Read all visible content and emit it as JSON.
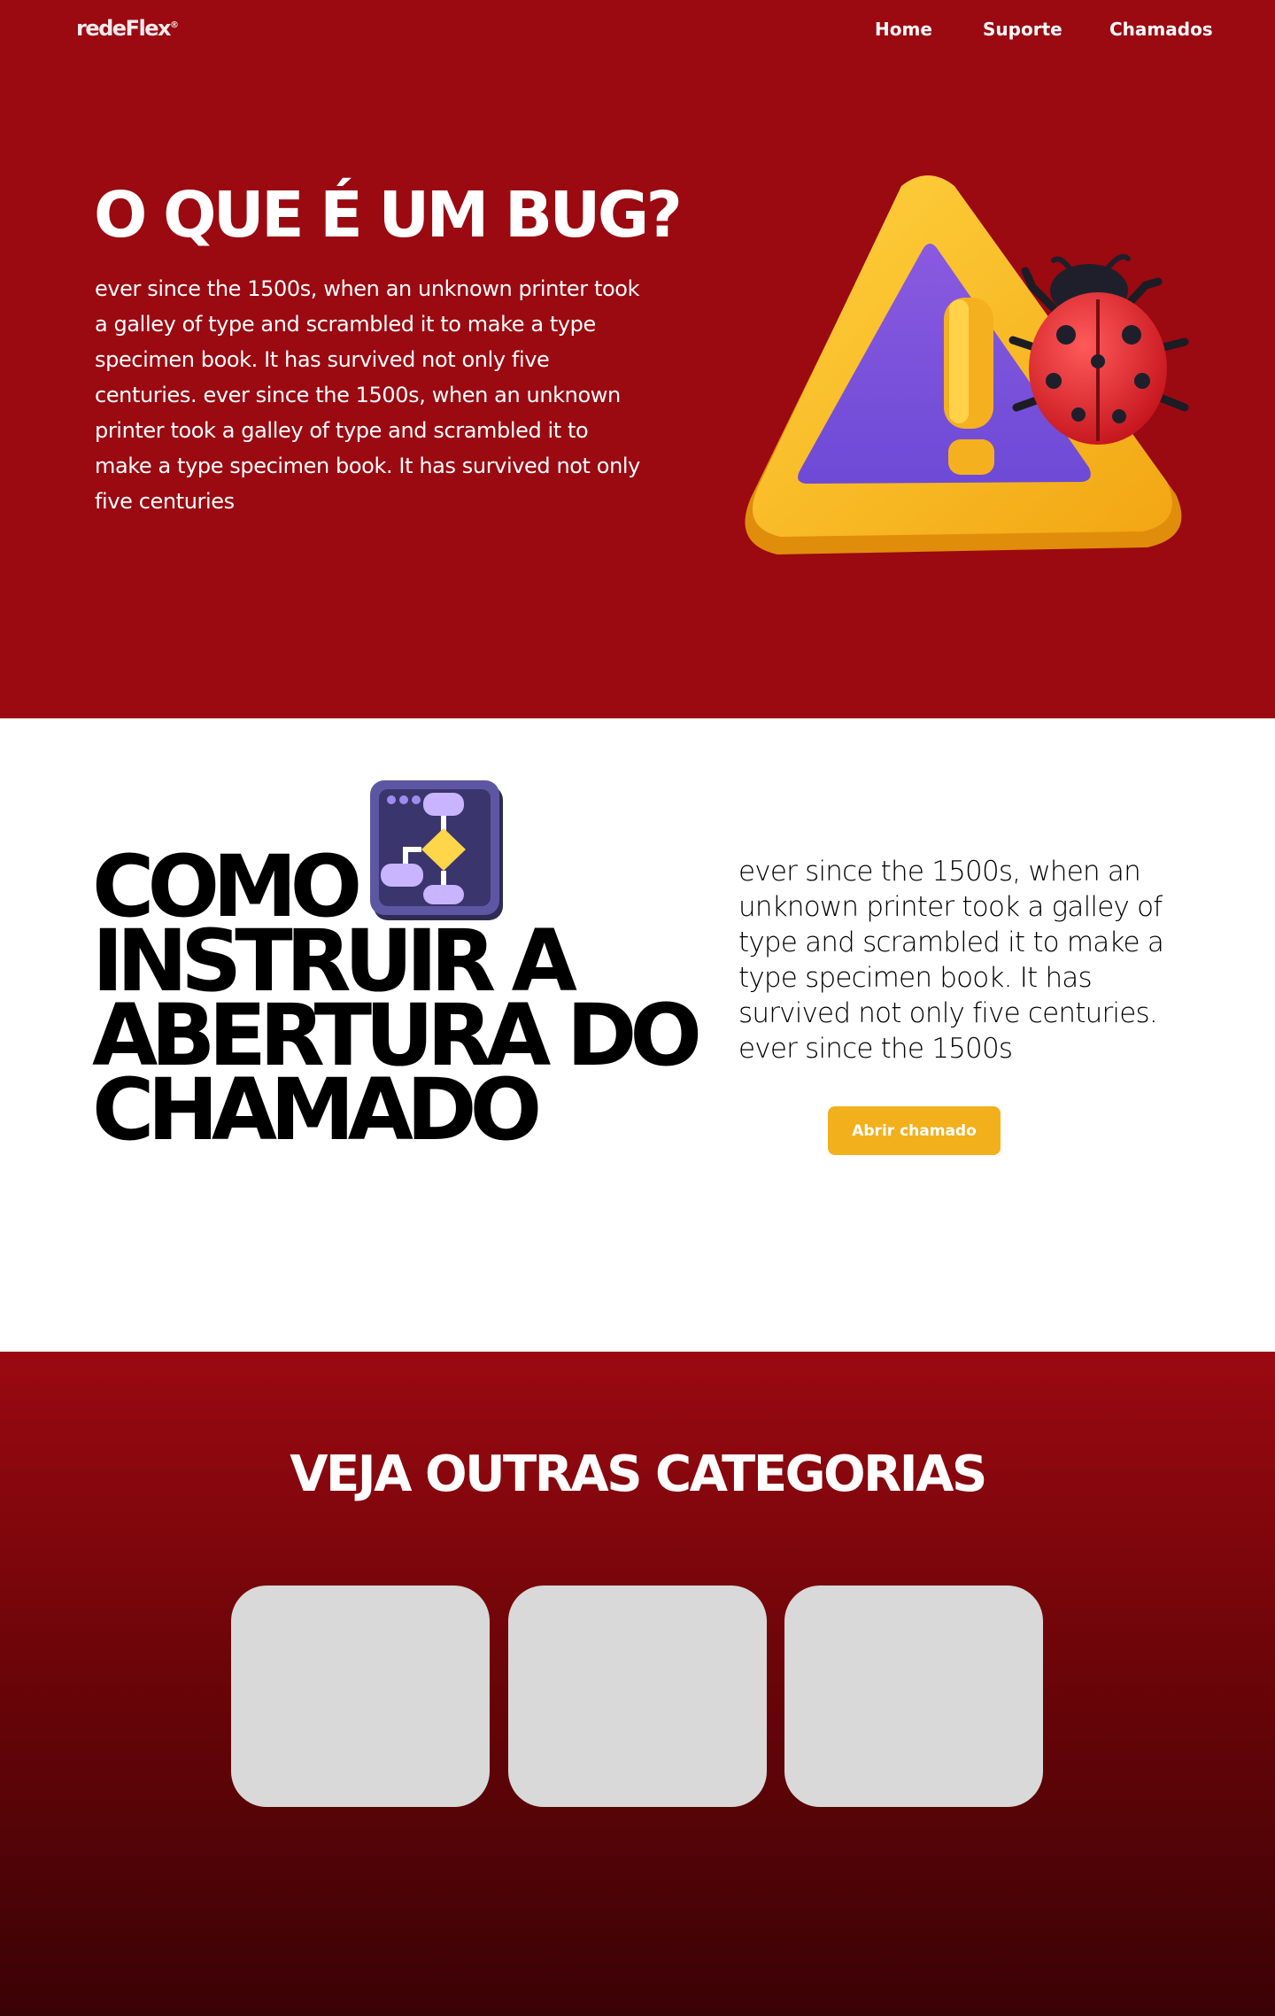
{
  "brand": {
    "logo_text": "redeFlex",
    "logo_mark": "®"
  },
  "nav": {
    "items": [
      "Home",
      "Suporte",
      "Chamados"
    ]
  },
  "hero": {
    "title": "O QUE É UM BUG?",
    "text": "ever since the 1500s, when an unknown printer took a galley of type and scrambled it to make a type specimen book. It has survived not only five centuries. ever since the 1500s, when an unknown printer took a galley of type and scrambled it to make a type specimen book. It has survived not only five centuries",
    "illustration": "warning-bug-icon"
  },
  "howto": {
    "title_lines": [
      "COMO",
      "INSTRUIR A",
      "ABERTURA DO",
      "CHAMADO"
    ],
    "text": "ever since the 1500s, when an unknown printer took a galley of type and scrambled it to make a type specimen book. It has survived not only five centuries. ever since the 1500s",
    "cta_label": "Abrir chamado",
    "illustration": "flowchart-icon"
  },
  "categories": {
    "title": "VEJA OUTRAS CATEGORIAS",
    "cards": [
      {},
      {},
      {}
    ]
  },
  "colors": {
    "primary_red": "#9b0911",
    "dark_red": "#3a0205",
    "accent_yellow": "#f3b01d",
    "card_gray": "#d9d9d9"
  }
}
